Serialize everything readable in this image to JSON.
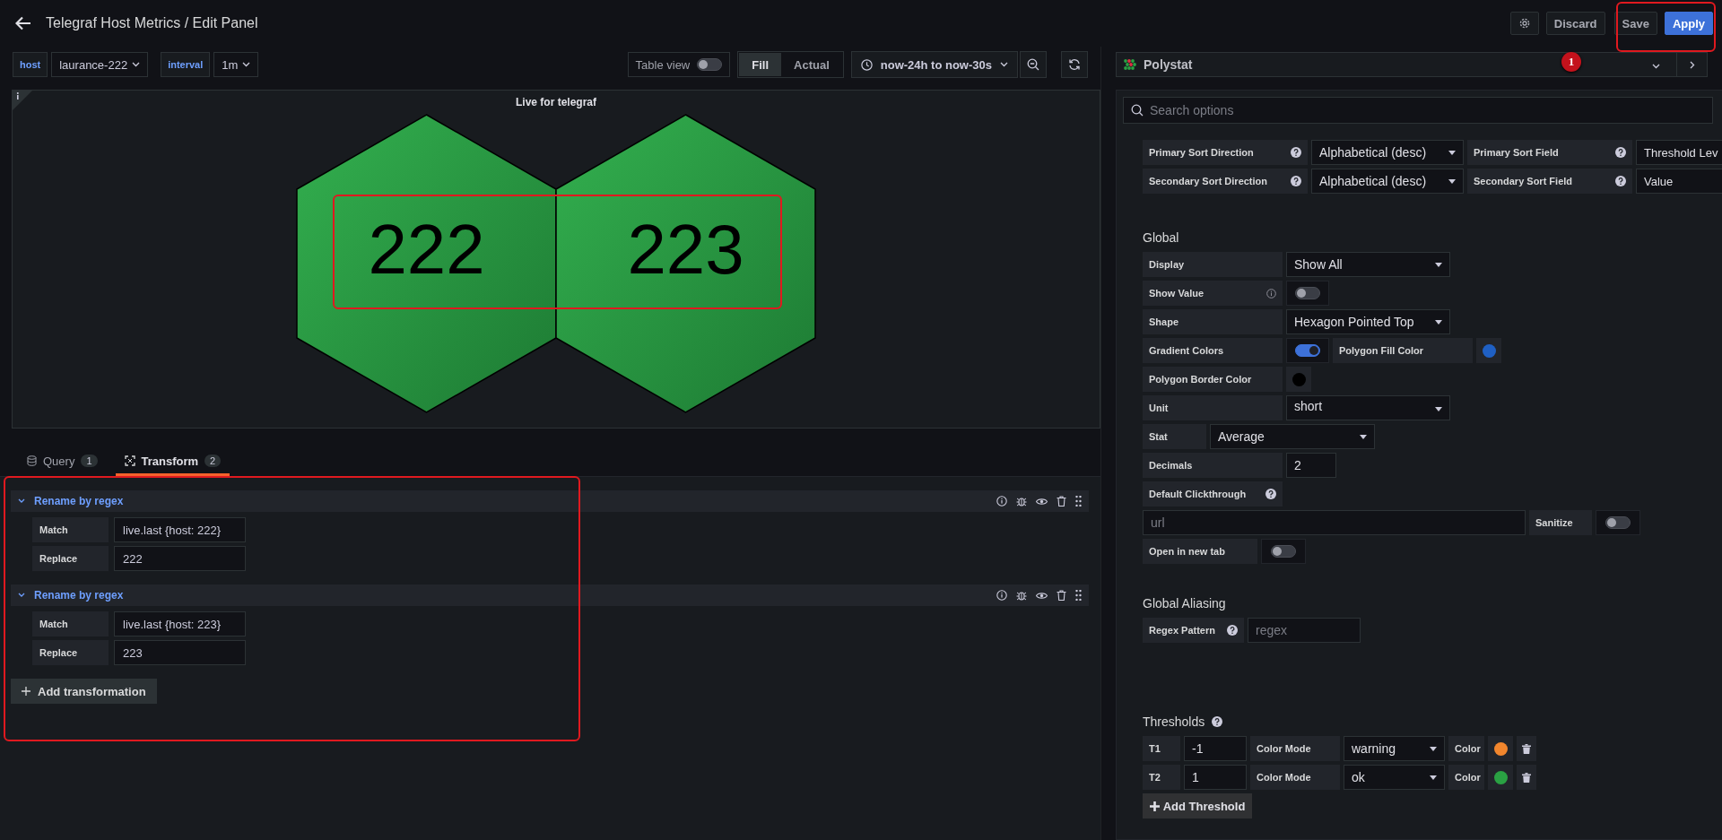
{
  "header": {
    "title": "Telegraf Host Metrics / Edit Panel",
    "discard": "Discard",
    "save": "Save",
    "apply": "Apply"
  },
  "toolbar": {
    "variables": [
      {
        "label": "host",
        "value": "laurance-222"
      },
      {
        "label": "interval",
        "value": "1m"
      }
    ],
    "table_view": {
      "label": "Table view",
      "on": false
    },
    "fit": [
      {
        "label": "Fill",
        "selected": true
      },
      {
        "label": "Actual",
        "selected": false
      }
    ],
    "time_range": "now-24h to now-30s"
  },
  "panel": {
    "title": "Live for telegraf",
    "gradient": true,
    "hexagons": [
      {
        "label": "222"
      },
      {
        "label": "223"
      }
    ]
  },
  "tabs": [
    {
      "label": "Query",
      "count": "1",
      "selected": false
    },
    {
      "label": "Transform",
      "count": "2",
      "selected": true
    }
  ],
  "transformations": [
    {
      "title": "Rename by regex",
      "expanded": true,
      "fields": [
        {
          "label": "Match",
          "value": "live.last {host: 222}"
        },
        {
          "label": "Replace",
          "value": "222"
        }
      ]
    },
    {
      "title": "Rename by regex",
      "expanded": true,
      "fields": [
        {
          "label": "Match",
          "value": "live.last {host: 223}"
        },
        {
          "label": "Replace",
          "value": "223"
        }
      ]
    }
  ],
  "add_transformation": "Add transformation",
  "visualization": {
    "name": "Polystat"
  },
  "annotation": {
    "marker": "1"
  },
  "options": {
    "search_placeholder": "Search options",
    "sort_rows": [
      [
        {
          "kind": "help_label",
          "text": "Primary Sort Direction"
        },
        {
          "kind": "select",
          "value": "Alphabetical (desc)"
        },
        {
          "kind": "help_label",
          "text": "Primary Sort Field"
        },
        {
          "kind": "value",
          "value": "Threshold Lev"
        }
      ],
      [
        {
          "kind": "help_label",
          "text": "Secondary Sort Direction"
        },
        {
          "kind": "select",
          "value": "Alphabetical (desc)"
        },
        {
          "kind": "help_label",
          "text": "Secondary Sort Field"
        },
        {
          "kind": "value",
          "value": "Value"
        }
      ]
    ],
    "global": {
      "title": "Global",
      "rows": [
        [
          {
            "kind": "label",
            "text": "Display"
          },
          {
            "kind": "select",
            "value": "Show All"
          }
        ],
        [
          {
            "kind": "info_label",
            "text": "Show Value"
          },
          {
            "kind": "switch",
            "on": false
          }
        ],
        [
          {
            "kind": "label",
            "text": "Shape"
          },
          {
            "kind": "select",
            "value": "Hexagon Pointed Top"
          }
        ],
        [
          {
            "kind": "label",
            "text": "Gradient Colors"
          },
          {
            "kind": "switch",
            "on": true
          },
          {
            "kind": "label",
            "text": "Polygon Fill Color"
          },
          {
            "kind": "color",
            "color": "#1f60c4"
          }
        ],
        [
          {
            "kind": "label",
            "text": "Polygon Border Color"
          },
          {
            "kind": "color",
            "color": "#000000"
          }
        ],
        [
          {
            "kind": "label",
            "text": "Unit"
          },
          {
            "kind": "select",
            "value": "short"
          }
        ],
        [
          {
            "kind": "label",
            "text": "Stat"
          },
          {
            "kind": "select",
            "value": "Average"
          }
        ],
        [
          {
            "kind": "label",
            "text": "Decimals"
          },
          {
            "kind": "input",
            "value": "2"
          }
        ],
        [
          {
            "kind": "help_label",
            "text": "Default Clickthrough"
          }
        ],
        [
          {
            "kind": "input",
            "placeholder": "url"
          },
          {
            "kind": "label",
            "text": "Sanitize"
          },
          {
            "kind": "switch",
            "on": false
          }
        ],
        [
          {
            "kind": "label",
            "text": "Open in new tab"
          },
          {
            "kind": "switch",
            "on": false
          }
        ]
      ]
    },
    "aliasing": {
      "title": "Global Aliasing",
      "rows": [
        [
          {
            "kind": "help_label",
            "text": "Regex Pattern"
          },
          {
            "kind": "input",
            "placeholder": "regex"
          }
        ]
      ]
    },
    "thresholds": {
      "title": "Thresholds",
      "rows": [
        [
          {
            "kind": "label",
            "text": "T1"
          },
          {
            "kind": "input",
            "value": "-1"
          },
          {
            "kind": "label",
            "text": "Color Mode"
          },
          {
            "kind": "select",
            "value": "warning"
          },
          {
            "kind": "label",
            "text": "Color"
          },
          {
            "kind": "color",
            "color": "#f2862d"
          },
          {
            "kind": "delete"
          }
        ],
        [
          {
            "kind": "label",
            "text": "T2"
          },
          {
            "kind": "input",
            "value": "1"
          },
          {
            "kind": "label",
            "text": "Color Mode"
          },
          {
            "kind": "select",
            "value": "ok"
          },
          {
            "kind": "label",
            "text": "Color"
          },
          {
            "kind": "color",
            "color": "#2aa143"
          },
          {
            "kind": "delete"
          }
        ]
      ],
      "add": "Add Threshold"
    }
  }
}
